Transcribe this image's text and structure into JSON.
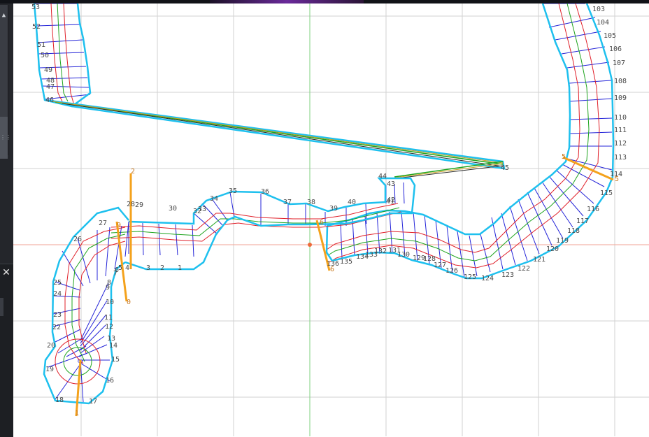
{
  "toolbar": {
    "scroll_up_icon": "▲",
    "grip_icon": "⋮⋮"
  },
  "panel": {
    "close_icon": "✕"
  },
  "colors": {
    "outline": "#1ec0ee",
    "cross_section": "#2424d8",
    "lane_red": "#e0202a",
    "lane_green": "#1ea41e",
    "grid": "#cfcfcf",
    "axis_green": "#6fc86f",
    "axis_red": "#f09a8e",
    "marker_orange": "#f4a21c"
  },
  "labels": {
    "segment_left": [
      "53",
      "52",
      "51",
      "50",
      "49",
      "48",
      "47",
      "46"
    ],
    "segment_right": [
      "103",
      "104",
      "105",
      "106",
      "107",
      "108",
      "109",
      "110",
      "111",
      "112",
      "113",
      "114",
      "115",
      "116",
      "117",
      "118",
      "119",
      "120",
      "121",
      "122",
      "123",
      "124",
      "125",
      "126",
      "127",
      "128",
      "129",
      "130",
      "131",
      "132",
      "133",
      "134",
      "135",
      "136"
    ],
    "middle": [
      "44",
      "45",
      "43",
      "42",
      "41",
      "40",
      "39",
      "38",
      "37",
      "36",
      "35",
      "34",
      "33",
      "32",
      "30",
      "29",
      "28",
      "27",
      "26"
    ],
    "loop": [
      "25",
      "24",
      "23",
      "22",
      "21",
      "20",
      "19",
      "18",
      "17",
      "16",
      "15",
      "14",
      "13",
      "12",
      "11",
      "10",
      "9",
      "8",
      "7",
      "6",
      "5",
      "4",
      "3",
      "2",
      "1",
      "0"
    ]
  }
}
